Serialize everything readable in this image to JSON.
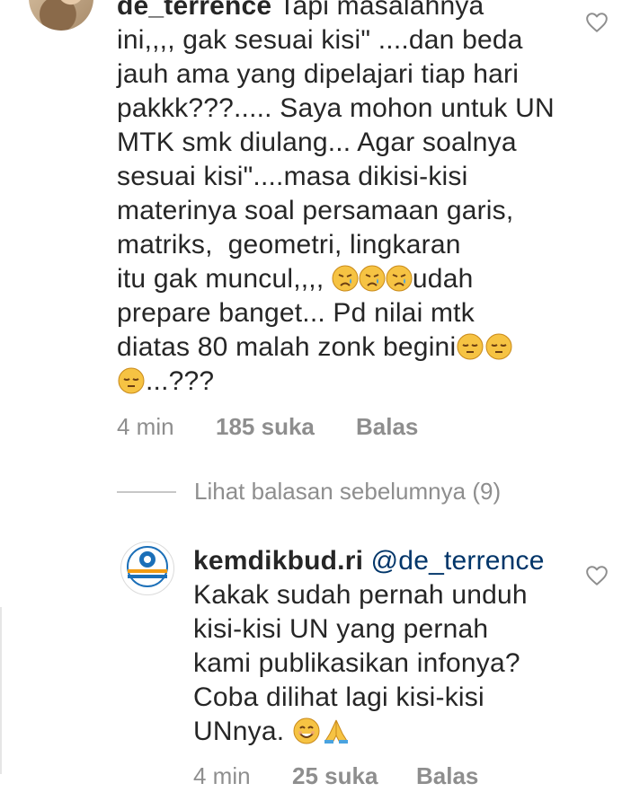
{
  "comment1": {
    "username": "de_terrence",
    "line_first": " Tapi masalahnya",
    "lines": [
      "ini,,,, gak sesuai kisi\" ....dan beda",
      "jauh ama yang dipelajari tiap hari",
      "pakkk???..... Saya mohon untuk UN",
      "MTK smk diulang... Agar soalnya",
      "sesuai kisi\"....masa dikisi-kisi",
      "materinya soal persamaan garis,",
      "matriks,  geometri, lingkaran"
    ],
    "line_emoji_prefix": "itu gak muncul,,,, ",
    "line_emoji_suffix": "udah",
    "line_after": "prepare banget... Pd nilai mtk",
    "line_last_prefix": "diatas 80 malah zonk begini",
    "line_tail": "...???",
    "time": "4 min",
    "likes": "185 suka",
    "reply": "Balas",
    "emoji_crying": "crying-face-emoji",
    "emoji_pensive": "pensive-face-emoji"
  },
  "view_replies": "Lihat balasan sebelumnya (9)",
  "comment2": {
    "username": "kemdikbud.ri",
    "mention": "@de_terrence",
    "lines": [
      "Kakak sudah pernah unduh",
      "kisi-kisi UN yang pernah",
      "kami publikasikan infonya?",
      "Coba dilihat lagi kisi-kisi"
    ],
    "line_last": "UNnya. ",
    "time": "4 min",
    "likes": "25 suka",
    "reply": "Balas",
    "emoji_smile": "smiling-face-emoji",
    "emoji_pray": "folded-hands-emoji"
  },
  "colors": {
    "text": "#262626",
    "meta": "#8e8e8e",
    "mention": "#003569",
    "divider": "#c7c7c7"
  },
  "icons": {
    "like": "heart-outline-icon"
  }
}
